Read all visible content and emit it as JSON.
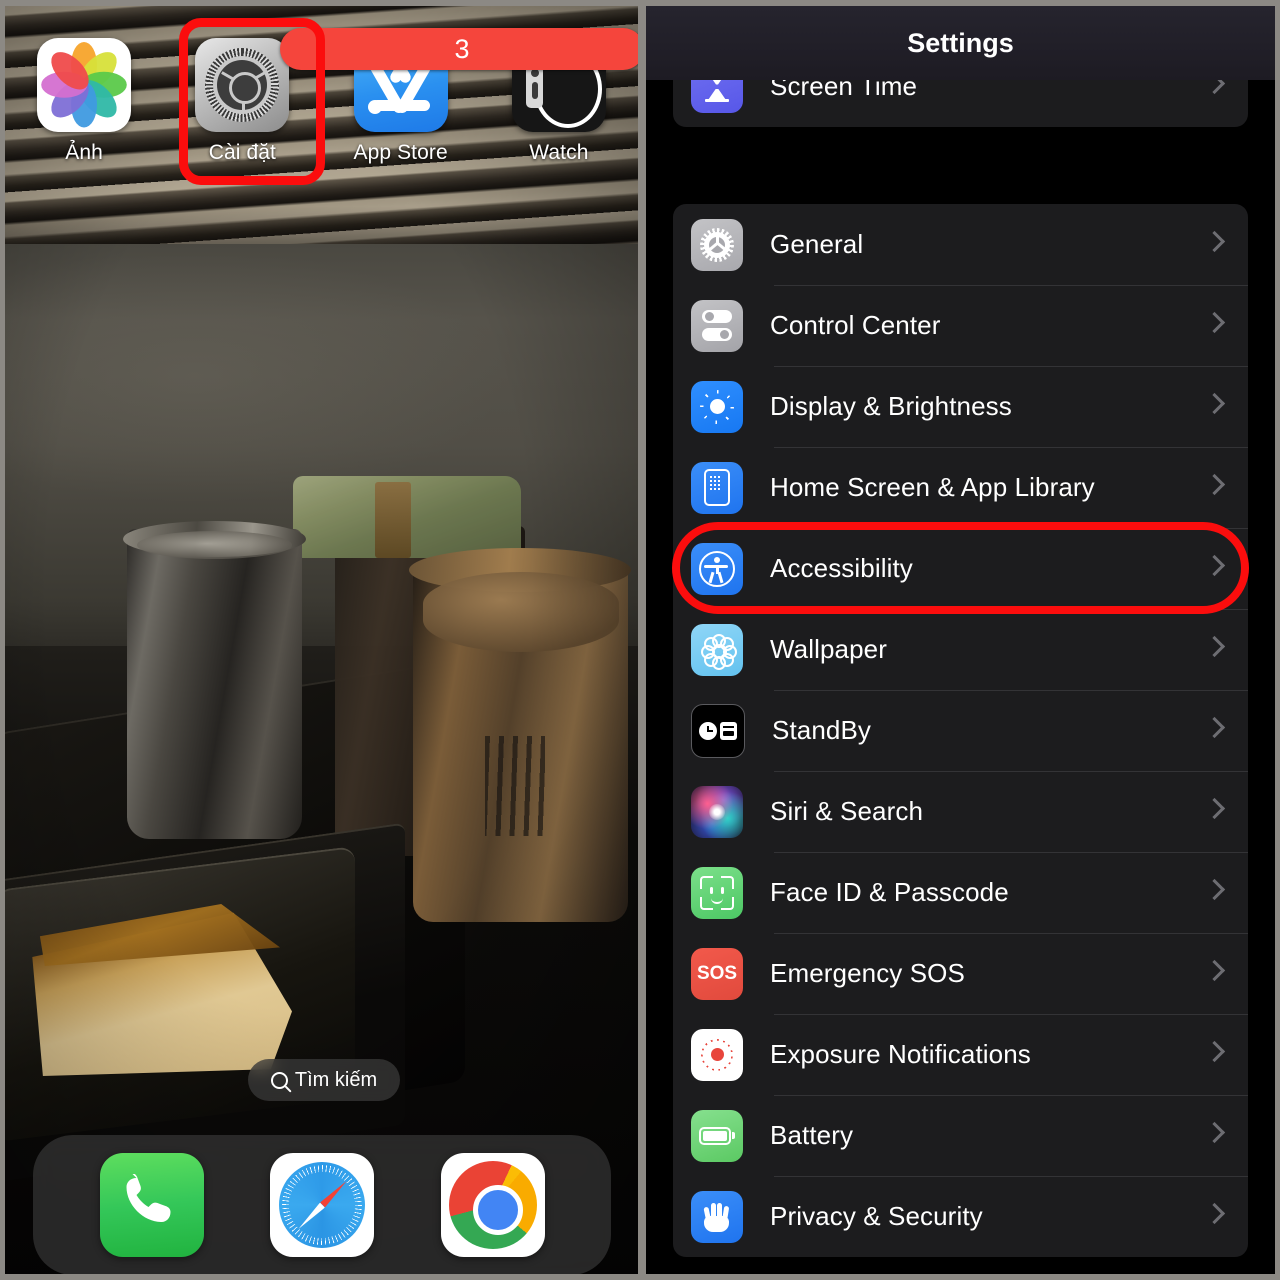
{
  "home_screen": {
    "apps": [
      {
        "label": "Ảnh",
        "icon": "photos-icon",
        "badge": null
      },
      {
        "label": "Cài đặt",
        "icon": "settings-gear-icon",
        "badge": "3"
      },
      {
        "label": "App Store",
        "icon": "app-store-icon",
        "badge": null
      },
      {
        "label": "Watch",
        "icon": "watch-icon",
        "badge": null
      }
    ],
    "search": {
      "label": "Tìm kiếm",
      "icon": "search-icon"
    },
    "dock": [
      {
        "label": "Phone",
        "icon": "phone-icon"
      },
      {
        "label": "Safari",
        "icon": "safari-compass-icon"
      },
      {
        "label": "Chrome",
        "icon": "chrome-icon"
      }
    ],
    "highlight": {
      "target": "Cài đặt",
      "color": "#fb0d0d"
    }
  },
  "settings": {
    "title": "Settings",
    "highlight": {
      "target": "Accessibility",
      "color": "#fb0d0d"
    },
    "groups": [
      {
        "rows": [
          {
            "label": "Screen Time",
            "icon": "hourglass-icon",
            "chevron": "chevron-right-icon",
            "color": "#5f5fe8"
          }
        ]
      },
      {
        "rows": [
          {
            "label": "General",
            "icon": "gear-icon",
            "chevron": "chevron-right-icon",
            "color": "#a8a8ad"
          },
          {
            "label": "Control Center",
            "icon": "sliders-icon",
            "chevron": "chevron-right-icon",
            "color": "#a3a3a8"
          },
          {
            "label": "Display & Brightness",
            "icon": "brightness-sun-icon",
            "chevron": "chevron-right-icon",
            "color": "#1778f2"
          },
          {
            "label": "Home Screen & App Library",
            "icon": "home-screen-grid-icon",
            "chevron": "chevron-right-icon",
            "color": "#1f74ef"
          },
          {
            "label": "Accessibility",
            "icon": "accessibility-person-icon",
            "chevron": "chevron-right-icon",
            "color": "#1f74ef"
          },
          {
            "label": "Wallpaper",
            "icon": "wallpaper-flower-icon",
            "chevron": "chevron-right-icon",
            "color": "#63c2ef"
          },
          {
            "label": "StandBy",
            "icon": "standby-clock-widget-icon",
            "chevron": "chevron-right-icon",
            "color": "#000000"
          },
          {
            "label": "Siri & Search",
            "icon": "siri-orb-icon",
            "chevron": "chevron-right-icon",
            "color": "#1a1430"
          },
          {
            "label": "Face ID & Passcode",
            "icon": "face-id-icon",
            "chevron": "chevron-right-icon",
            "color": "#4cc764"
          },
          {
            "label": "Emergency SOS",
            "icon": "sos-icon",
            "chevron": "chevron-right-icon",
            "color": "#e14a3d"
          },
          {
            "label": "Exposure Notifications",
            "icon": "exposure-dot-icon",
            "chevron": "chevron-right-icon",
            "color": "#ffffff"
          },
          {
            "label": "Battery",
            "icon": "battery-icon",
            "chevron": "chevron-right-icon",
            "color": "#5bc963"
          },
          {
            "label": "Privacy & Security",
            "icon": "privacy-hand-icon",
            "chevron": "chevron-right-icon",
            "color": "#1f74ef"
          }
        ]
      }
    ],
    "sos_glyph": "SOS"
  }
}
